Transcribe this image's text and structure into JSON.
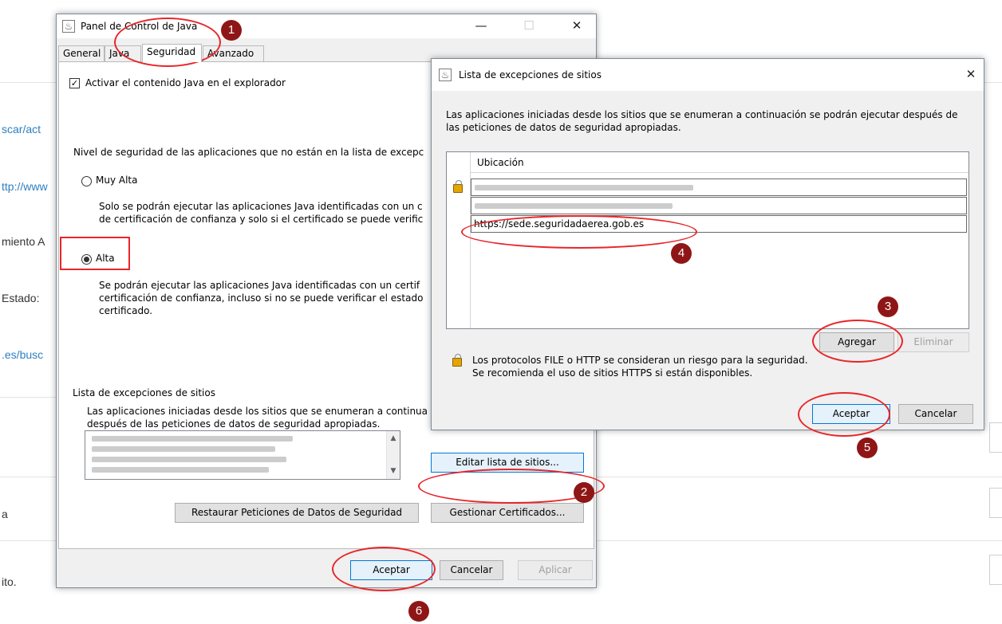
{
  "background": {
    "fragments": [
      "scar/act",
      "ttp://www",
      "miento A",
      "Estado:",
      ".es/busc",
      "a",
      "ito."
    ],
    "colors": {
      "link": "#2d7fc1",
      "text": "#333333"
    }
  },
  "java_panel": {
    "title": "Panel de Control de Java",
    "tabs": [
      "General",
      "Java",
      "Seguridad",
      "Avanzado"
    ],
    "active_tab": "Seguridad",
    "enable_java_label": "Activar el contenido Java en el explorador",
    "enable_java_checked": true,
    "security_level_label": "Nivel de seguridad de las aplicaciones que no están en la lista de excepc",
    "options": [
      {
        "label": "Muy Alta",
        "selected": false,
        "desc": [
          "Solo se podrán ejecutar las aplicaciones Java identificadas con un c",
          "de certificación de confianza y solo si el certificado se puede verific"
        ]
      },
      {
        "label": "Alta",
        "selected": true,
        "desc": [
          "Se podrán ejecutar las aplicaciones Java identificadas con un certif",
          "certificación de confianza, incluso si no se puede verificar el estado",
          "certificado."
        ]
      }
    ],
    "exceptions_title": "Lista de excepciones de sitios",
    "exceptions_desc": [
      "Las aplicaciones iniciadas desde los sitios que se enumeran a continua",
      "después de las peticiones de datos de seguridad apropiadas."
    ],
    "edit_sites_button": "Editar lista de sitios...",
    "restore_button": "Restaurar Peticiones de Datos de Seguridad",
    "certificates_button": "Gestionar Certificados...",
    "accept_button": "Aceptar",
    "cancel_button": "Cancelar",
    "apply_button": "Aplicar"
  },
  "exceptions_dialog": {
    "title": "Lista de excepciones de sitios",
    "description": [
      "Las aplicaciones iniciadas desde los sitios que se enumeran a continuación se podrán ejecutar después de",
      "las peticiones de datos de seguridad apropiadas."
    ],
    "column_header": "Ubicación",
    "new_entry": "https://sede.seguridadaerea.gob.es",
    "add_button": "Agregar",
    "remove_button": "Eliminar",
    "warning": [
      "Los protocolos FILE o HTTP se consideran un riesgo para la seguridad.",
      "Se recomienda el uso de sitios HTTPS si están disponibles."
    ],
    "accept_button": "Aceptar",
    "cancel_button": "Cancelar"
  },
  "annotations": {
    "steps": [
      "1",
      "2",
      "3",
      "4",
      "5",
      "6"
    ],
    "color": "#e8262a",
    "badge_color": "#8f1616"
  }
}
